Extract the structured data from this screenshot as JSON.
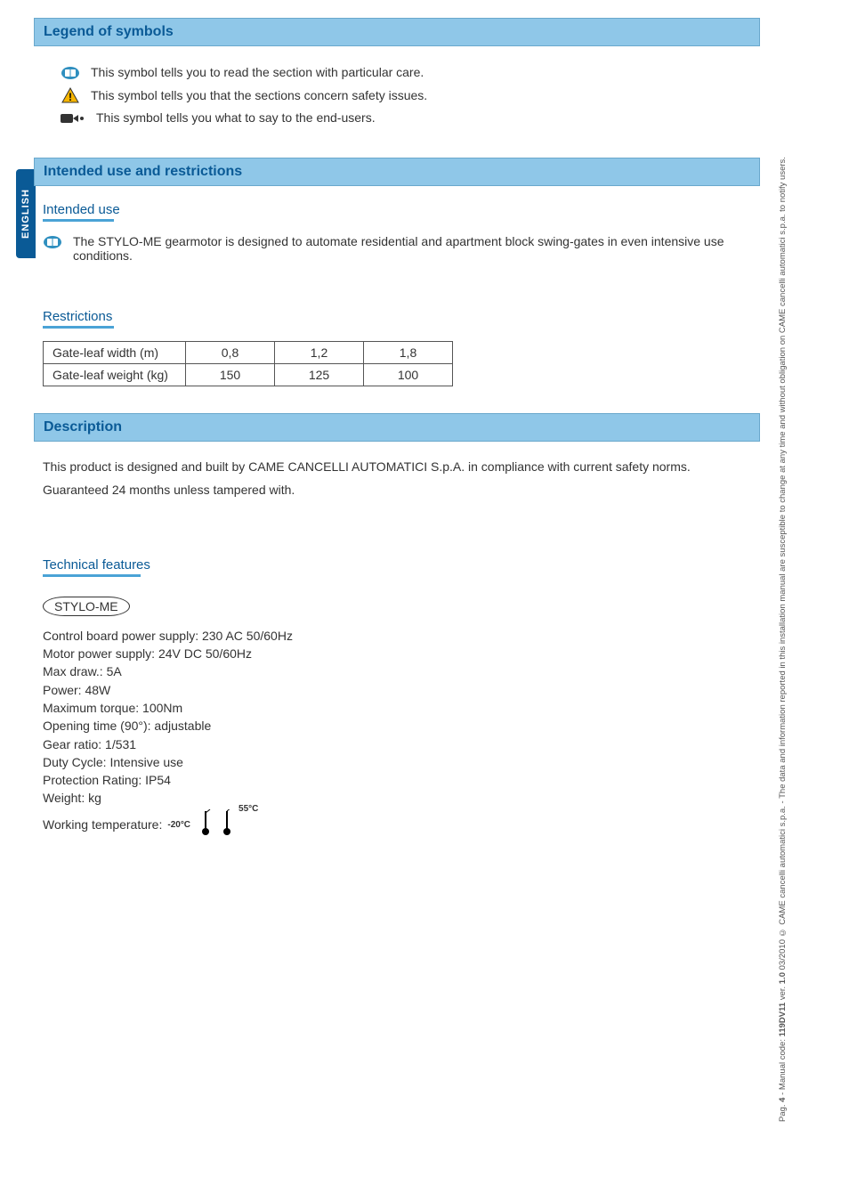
{
  "lang_tab": "ENGLISH",
  "sections": {
    "legend": {
      "title": "Legend of symbols",
      "rows": [
        {
          "icon": "read-icon",
          "text": "This symbol tells you to read the section with particular care."
        },
        {
          "icon": "warning-icon",
          "text": "This symbol tells you that the sections concern safety issues."
        },
        {
          "icon": "user-icon",
          "text": "This symbol tells you what to say to the end-users."
        }
      ]
    },
    "intended": {
      "title": "Intended use and restrictions",
      "sub1": "Intended use",
      "sub1_text": "The STYLO-ME gearmotor is designed to automate residential and apartment block swing-gates in even intensive use conditions.",
      "sub2": "Restrictions",
      "table": {
        "row1_label": "Gate-leaf width (m)",
        "row1": [
          "0,8",
          "1,2",
          "1,8"
        ],
        "row2_label": "Gate-leaf weight (kg)",
        "row2": [
          "150",
          "125",
          "100"
        ]
      }
    },
    "description": {
      "title": "Description",
      "text1": "This product is designed and built by CAME CANCELLI AUTOMATICI S.p.A. in compliance with current safety norms.",
      "text2": "Guaranteed 24 months unless tampered with.",
      "tech_heading": "Technical features",
      "model": "STYLO-ME",
      "features": [
        "Control board power supply: 230 AC 50/60Hz",
        "Motor power supply: 24V DC 50/60Hz",
        "Max draw.: 5A",
        "Power: 48W",
        "Maximum torque: 100Nm",
        "Opening time (90°): adjustable",
        "Gear ratio: 1/531",
        "Duty Cycle: Intensive use",
        "Protection Rating: IP54",
        "Weight:    kg"
      ],
      "working_temp_label": "Working temperature:",
      "temp_low": "-20°C",
      "temp_high": "55°C"
    }
  },
  "footer": {
    "pag_label": "Pag.",
    "pag_num": "4",
    "sep1": " - Manual code: ",
    "code": "119DV11",
    "ver_label": " ver. ",
    "ver": "1.0",
    "date": "  03/2010  © CAME cancelli automatici s.p.a. - The data and information reported in this installation manual are susceptible to change at any time and without obligation on CAME cancelli automatici s.p.a. to notify users."
  }
}
